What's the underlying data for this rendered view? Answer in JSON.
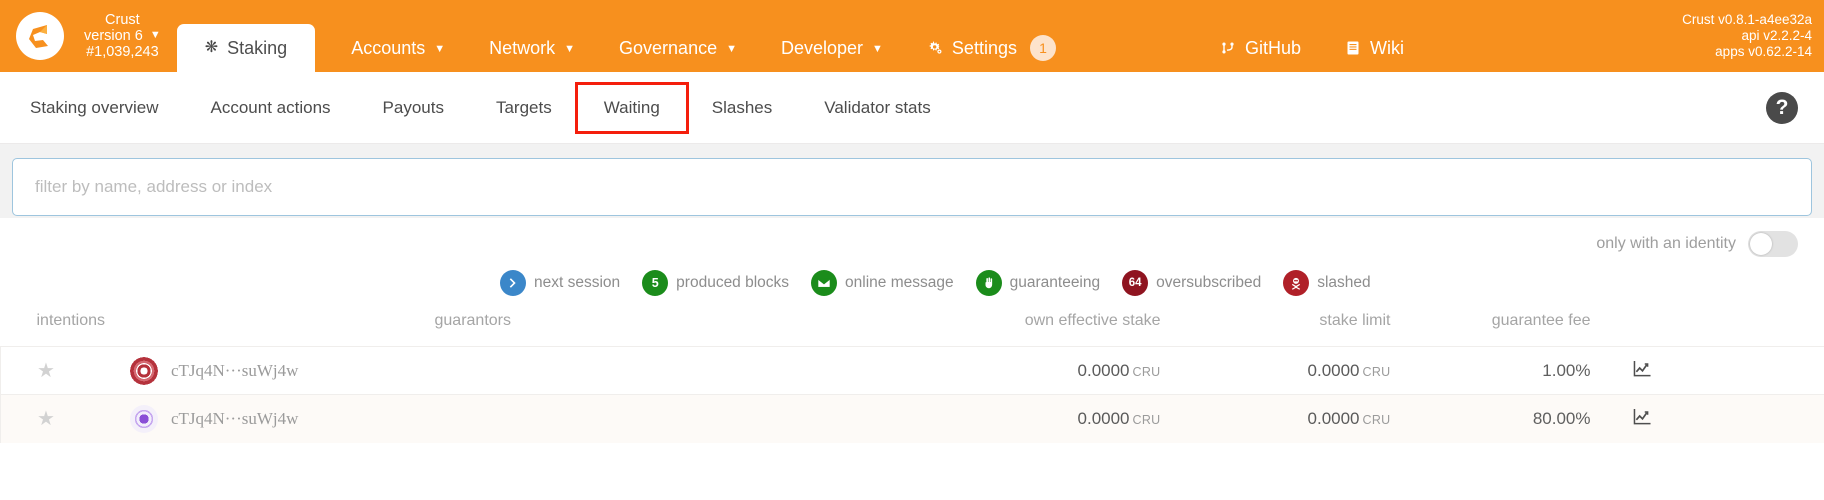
{
  "topbar": {
    "logo_name": "crust-logo",
    "chain": {
      "name": "Crust",
      "version": "version 6",
      "block": "#1,039,243",
      "caret": "▼"
    },
    "active_tab": {
      "label": "Staking",
      "icon": "asterisk-icon"
    },
    "nav_items": [
      {
        "label": "Accounts",
        "caret": "▼",
        "name": "nav-accounts"
      },
      {
        "label": "Network",
        "caret": "▼",
        "name": "nav-network"
      },
      {
        "label": "Governance",
        "caret": "▼",
        "name": "nav-governance"
      },
      {
        "label": "Developer",
        "caret": "▼",
        "name": "nav-developer"
      },
      {
        "label": "Settings",
        "caret": "",
        "badge": "1",
        "name": "nav-settings",
        "icon": "gears-icon"
      }
    ],
    "links": [
      {
        "label": "GitHub",
        "icon": "git-branch-icon",
        "name": "nav-github"
      },
      {
        "label": "Wiki",
        "icon": "book-icon",
        "name": "nav-wiki"
      }
    ],
    "versions": {
      "line1": "Crust v0.8.1-a4ee32a",
      "line2": "api v2.2.2-4",
      "line3": "apps v0.62.2-14"
    },
    "accent": "#f7901e"
  },
  "subbar": {
    "tabs": [
      {
        "label": "Staking overview",
        "active": false
      },
      {
        "label": "Account actions",
        "active": false
      },
      {
        "label": "Payouts",
        "active": false
      },
      {
        "label": "Targets",
        "active": false
      },
      {
        "label": "Waiting",
        "active": true
      },
      {
        "label": "Slashes",
        "active": false
      },
      {
        "label": "Validator stats",
        "active": false
      }
    ],
    "highlight_color": "#f41e0c",
    "help_label": "?"
  },
  "filter": {
    "placeholder": "filter by name, address or index",
    "value": ""
  },
  "identity_toggle": {
    "label": "only with an identity",
    "on": false
  },
  "legend": [
    {
      "key": "next-session",
      "glyph": "❯",
      "text": "next session",
      "color": "#3b87c9"
    },
    {
      "key": "produced-blocks",
      "glyph": "5",
      "text": "produced blocks",
      "color": "#1b8c1b"
    },
    {
      "key": "online-message",
      "glyph": "envelope",
      "text": "online message",
      "color": "#1b8c1b"
    },
    {
      "key": "guaranteeing",
      "glyph": "hand",
      "text": "guaranteeing",
      "color": "#1b8c1b"
    },
    {
      "key": "oversubscribed",
      "glyph": "64",
      "text": "oversubscribed",
      "color": "#8f1420"
    },
    {
      "key": "slashed",
      "glyph": "skull",
      "text": "slashed",
      "color": "#b02028"
    }
  ],
  "table": {
    "headers": {
      "intentions": "intentions",
      "guarantors": "guarantors",
      "own_effective_stake": "own effective stake",
      "stake_limit": "stake limit",
      "guarantee_fee": "guarantee fee"
    },
    "rows": [
      {
        "favorite_icon": "star-icon",
        "identicon_color": "#b5323c",
        "address": "cTJq4N···suWj4w",
        "guarantors": "",
        "own_effective_stake": "0.0000",
        "own_effective_stake_unit": "CRU",
        "stake_limit": "0.0000",
        "stake_limit_unit": "CRU",
        "guarantee_fee": "1.00%"
      },
      {
        "favorite_icon": "star-icon",
        "identicon_color": "#8a4fd6",
        "address": "cTJq4N···suWj4w",
        "guarantors": "",
        "own_effective_stake": "0.0000",
        "own_effective_stake_unit": "CRU",
        "stake_limit": "0.0000",
        "stake_limit_unit": "CRU",
        "guarantee_fee": "80.00%"
      }
    ]
  }
}
